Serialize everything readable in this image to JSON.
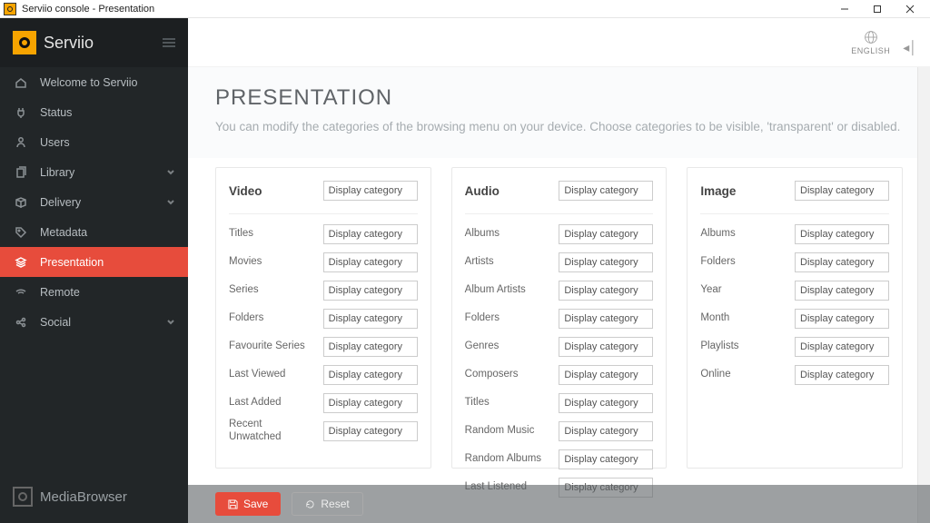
{
  "window": {
    "title": "Serviio console - Presentation"
  },
  "brand": {
    "name": "Serviio",
    "secondary": "MediaBrowser"
  },
  "topbar": {
    "language": "ENGLISH"
  },
  "sidebar": {
    "items": [
      {
        "key": "welcome",
        "label": "Welcome to Serviio",
        "icon": "home",
        "expandable": false
      },
      {
        "key": "status",
        "label": "Status",
        "icon": "plug",
        "expandable": false
      },
      {
        "key": "users",
        "label": "Users",
        "icon": "user",
        "expandable": false
      },
      {
        "key": "library",
        "label": "Library",
        "icon": "files",
        "expandable": true
      },
      {
        "key": "delivery",
        "label": "Delivery",
        "icon": "box",
        "expandable": true
      },
      {
        "key": "metadata",
        "label": "Metadata",
        "icon": "tag",
        "expandable": false
      },
      {
        "key": "presentation",
        "label": "Presentation",
        "icon": "layers",
        "expandable": false,
        "active": true
      },
      {
        "key": "remote",
        "label": "Remote",
        "icon": "wifi",
        "expandable": false
      },
      {
        "key": "social",
        "label": "Social",
        "icon": "share",
        "expandable": true
      }
    ]
  },
  "page": {
    "title": "PRESENTATION",
    "description": "You can modify the categories of the browsing menu on your device. Choose categories to be visible, 'transparent' or disabled."
  },
  "default_select": "Display category",
  "panels": [
    {
      "title": "Video",
      "header_select": "Display category",
      "rows": [
        {
          "label": "Titles",
          "value": "Display category"
        },
        {
          "label": "Movies",
          "value": "Display category"
        },
        {
          "label": "Series",
          "value": "Display category"
        },
        {
          "label": "Folders",
          "value": "Display category"
        },
        {
          "label": "Favourite Series",
          "value": "Display category"
        },
        {
          "label": "Last Viewed",
          "value": "Display category"
        },
        {
          "label": "Last Added",
          "value": "Display category"
        },
        {
          "label": "Recent Unwatched",
          "value": "Display category"
        }
      ]
    },
    {
      "title": "Audio",
      "header_select": "Display category",
      "rows": [
        {
          "label": "Albums",
          "value": "Display category"
        },
        {
          "label": "Artists",
          "value": "Display category"
        },
        {
          "label": "Album Artists",
          "value": "Display category"
        },
        {
          "label": "Folders",
          "value": "Display category"
        },
        {
          "label": "Genres",
          "value": "Display category"
        },
        {
          "label": "Composers",
          "value": "Display category"
        },
        {
          "label": "Titles",
          "value": "Display category"
        },
        {
          "label": "Random Music",
          "value": "Display category"
        },
        {
          "label": "Random Albums",
          "value": "Display category"
        },
        {
          "label": "Last Listened",
          "value": "Display category"
        }
      ]
    },
    {
      "title": "Image",
      "header_select": "Display category",
      "rows": [
        {
          "label": "Albums",
          "value": "Display category"
        },
        {
          "label": "Folders",
          "value": "Display category"
        },
        {
          "label": "Year",
          "value": "Display category"
        },
        {
          "label": "Month",
          "value": "Display category"
        },
        {
          "label": "Playlists",
          "value": "Display category"
        },
        {
          "label": "Online",
          "value": "Display category"
        }
      ]
    }
  ],
  "footer": {
    "save": "Save",
    "reset": "Reset"
  }
}
